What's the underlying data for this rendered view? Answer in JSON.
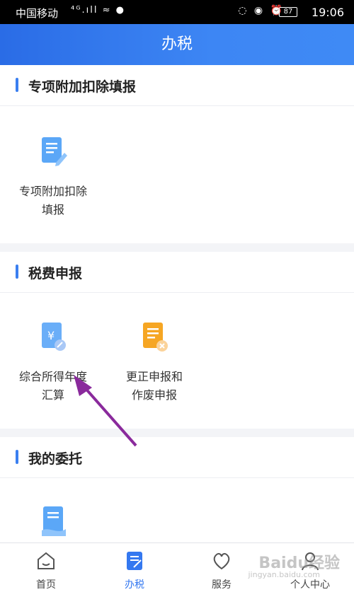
{
  "status_bar": {
    "carrier": "中国移动",
    "signal": "⁴ᴳ.ıll ≈ ●",
    "icons": "◌ ◉ ⏰",
    "battery": "87",
    "time": "19:06"
  },
  "header": {
    "title": "办税"
  },
  "sections": {
    "s1": {
      "title": "专项附加扣除填报",
      "items": [
        {
          "label": "专项附加扣除\n填报",
          "icon": "document-edit-icon"
        }
      ]
    },
    "s2": {
      "title": "税费申报",
      "items": [
        {
          "label": "综合所得年度\n汇算",
          "icon": "yuan-document-icon"
        },
        {
          "label": "更正申报和\n作废申报",
          "icon": "document-cancel-icon"
        }
      ]
    },
    "s3": {
      "title": "我的委托",
      "items": [
        {
          "label": "",
          "icon": "entrust-document-icon"
        }
      ]
    }
  },
  "tabbar": {
    "tabs": [
      {
        "label": "首页",
        "icon": "home-icon"
      },
      {
        "label": "办税",
        "icon": "tax-doc-icon",
        "active": true
      },
      {
        "label": "服务",
        "icon": "heart-service-icon"
      },
      {
        "label": "个人中心",
        "icon": "person-icon"
      }
    ]
  },
  "watermark": {
    "brand": "Baidu经验",
    "url": "jingyan.baidu.com"
  },
  "colors": {
    "accent": "#3478f0",
    "annotation_arrow": "#8a2a9c"
  }
}
